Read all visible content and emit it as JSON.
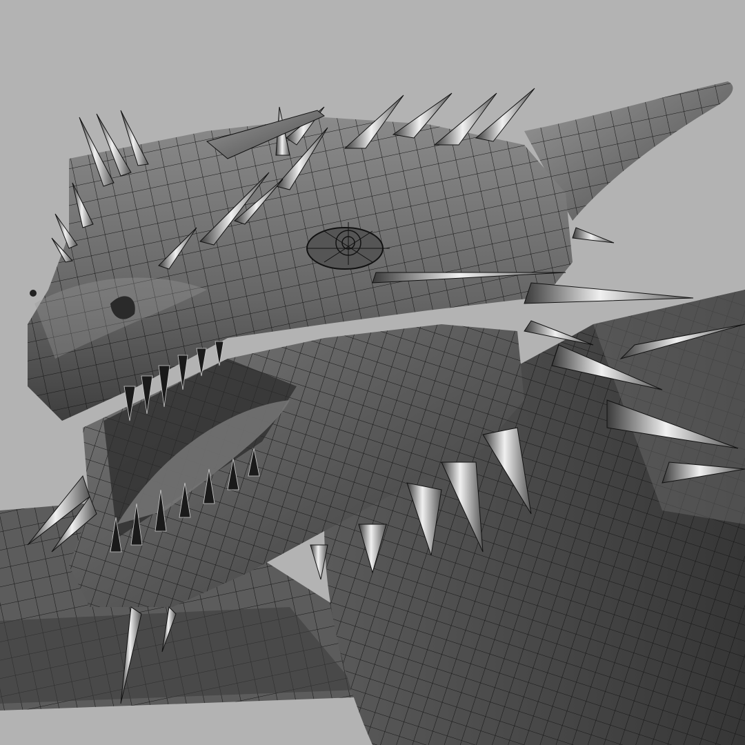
{
  "viewport": {
    "background": "#b3b3b3",
    "render_style": "wireframe-on-shaded",
    "subject": "dragon-head-mesh"
  },
  "colors": {
    "mesh_dark": "#3a3a3a",
    "mesh_mid": "#6b6b6b",
    "mesh_light": "#8f8f8f",
    "wire": "#111111",
    "spike_highlight": "#e8e8e8",
    "spike_shadow": "#2a2a2a"
  }
}
